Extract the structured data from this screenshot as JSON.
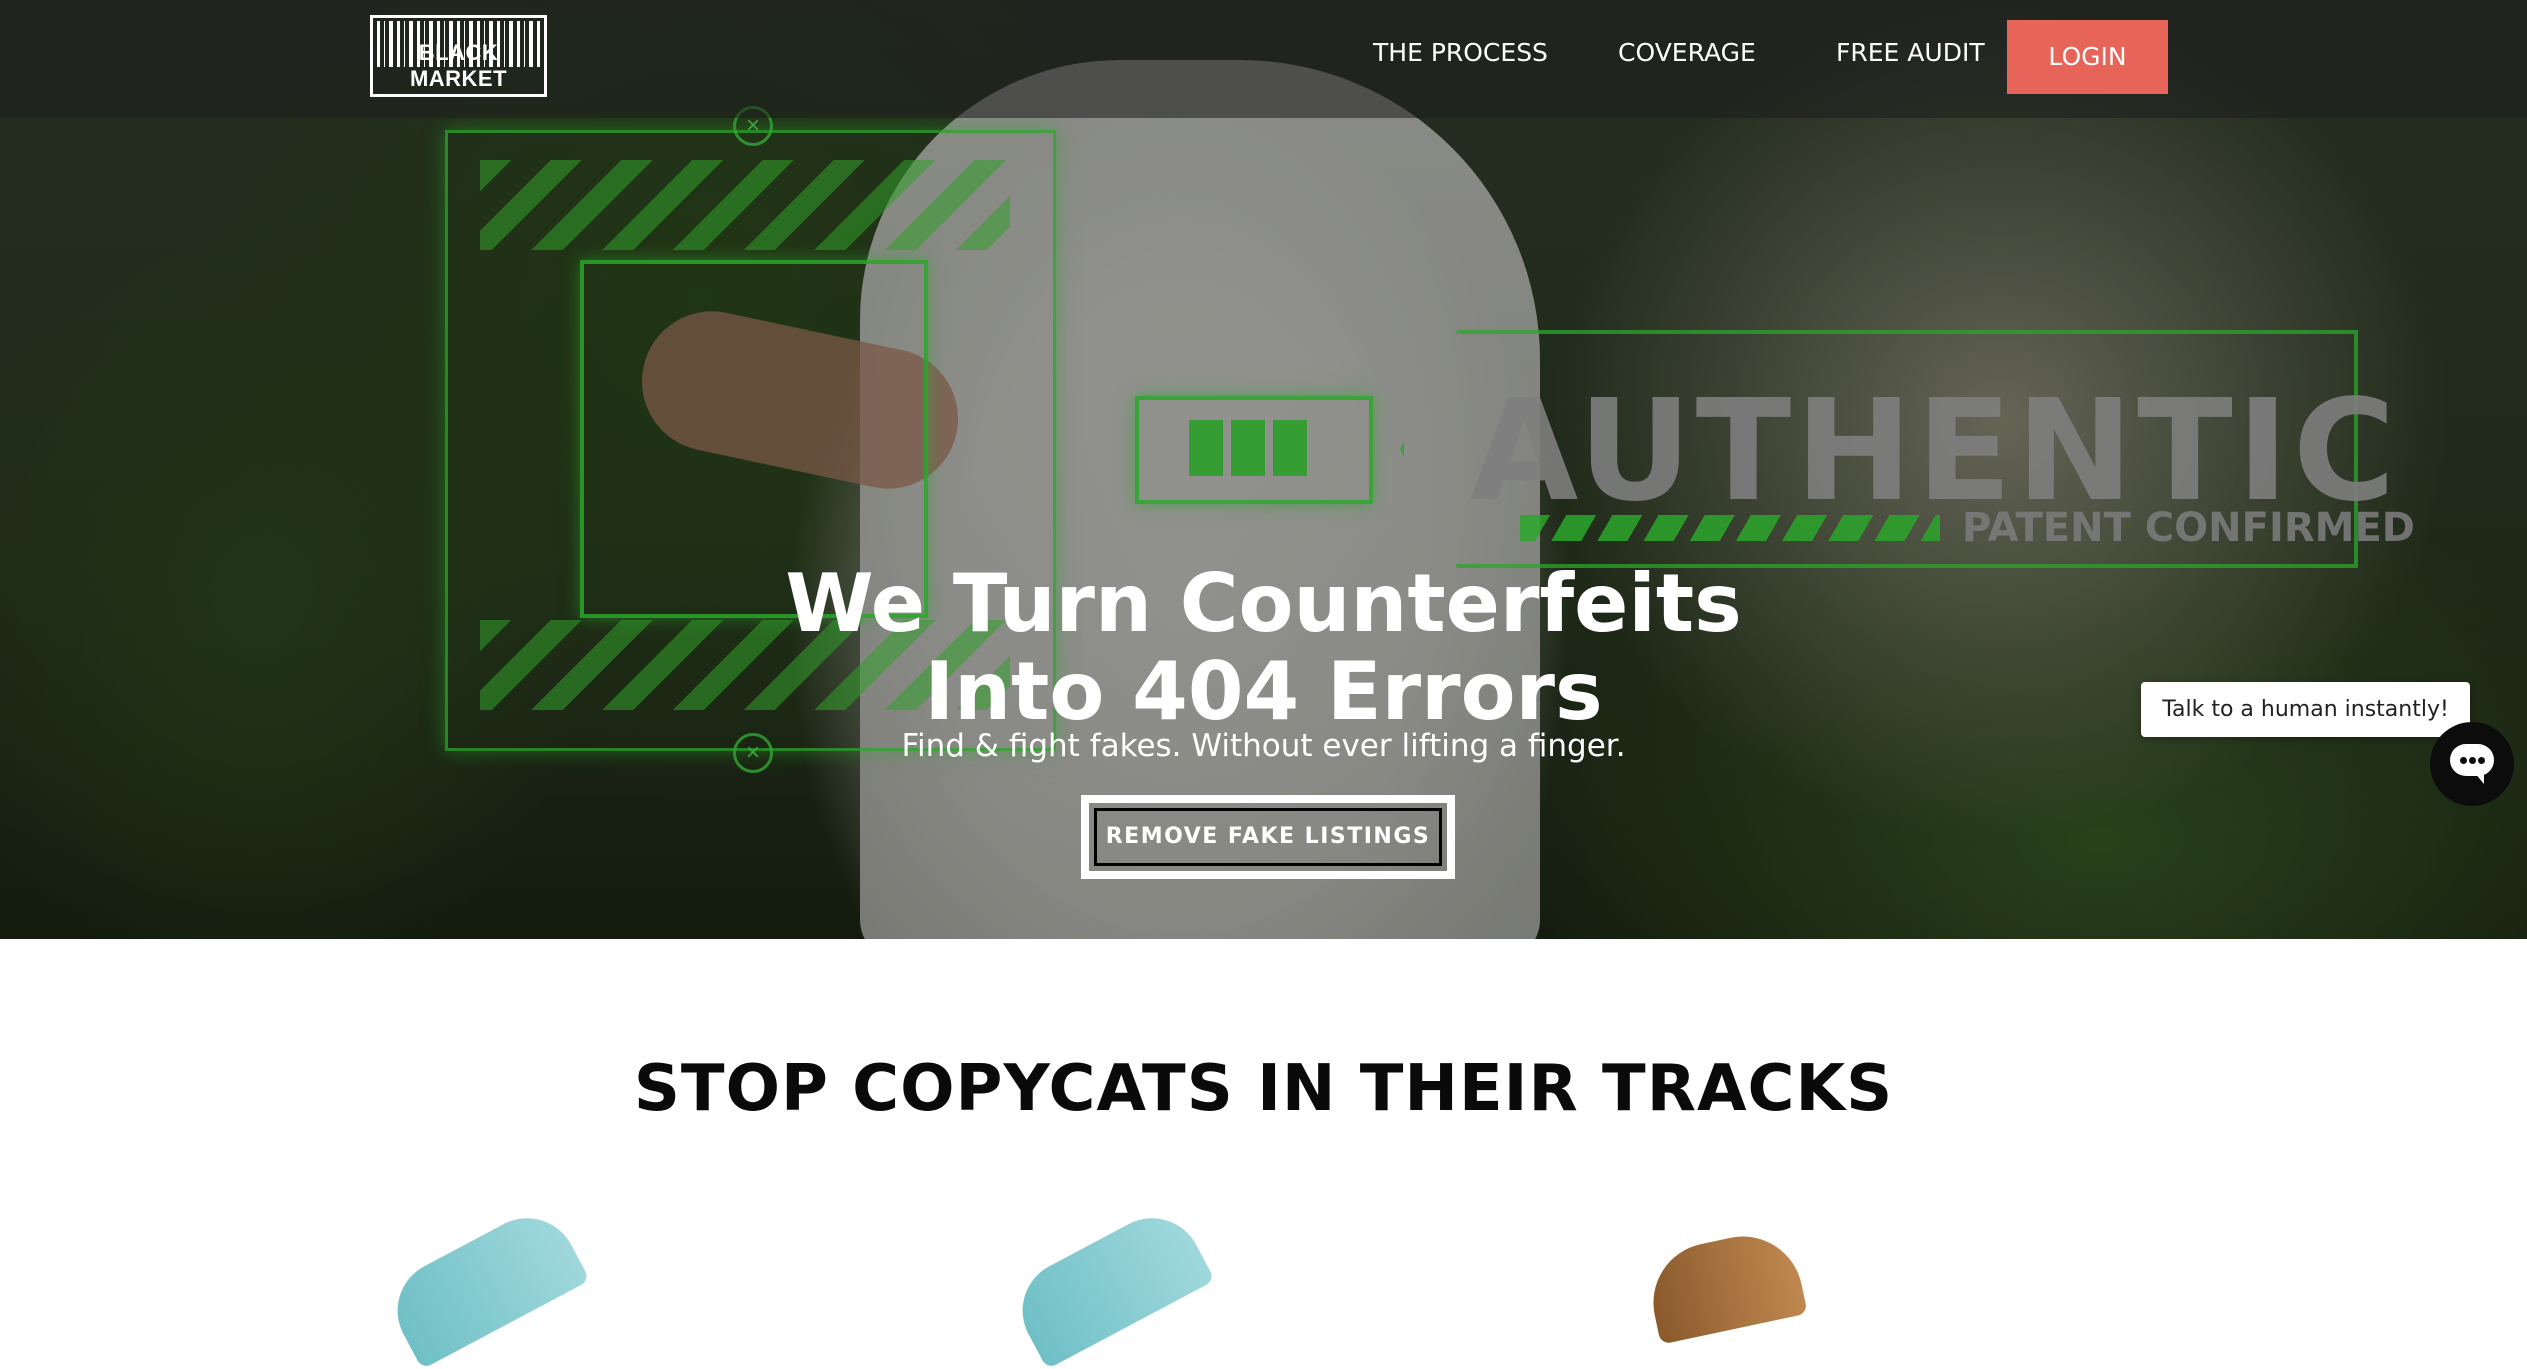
{
  "nav": {
    "logo_text": "BLACK MARKET",
    "links": [
      "THE PROCESS",
      "COVERAGE",
      "FREE AUDIT"
    ],
    "login_label": "LOGIN"
  },
  "hero": {
    "headline_line1": "We Turn Counterfeits",
    "headline_line2": "Into 404 Errors",
    "subheadline": "Find & fight fakes. Without ever lifting a finger.",
    "cta_label": "REMOVE FAKE LISTINGS",
    "image_overlay": {
      "title": "AUTHENTIC",
      "subtitle": "PATENT CONFIRMED"
    }
  },
  "chat": {
    "prompt": "Talk to a human instantly!",
    "icon": "chat-icon"
  },
  "section": {
    "title": "STOP COPYCATS IN THEIR TRACKS"
  },
  "colors": {
    "login_bg": "#e66458",
    "nav_overlay": "rgba(30,30,30,0.55)",
    "hud_green": "#3ce63c"
  }
}
